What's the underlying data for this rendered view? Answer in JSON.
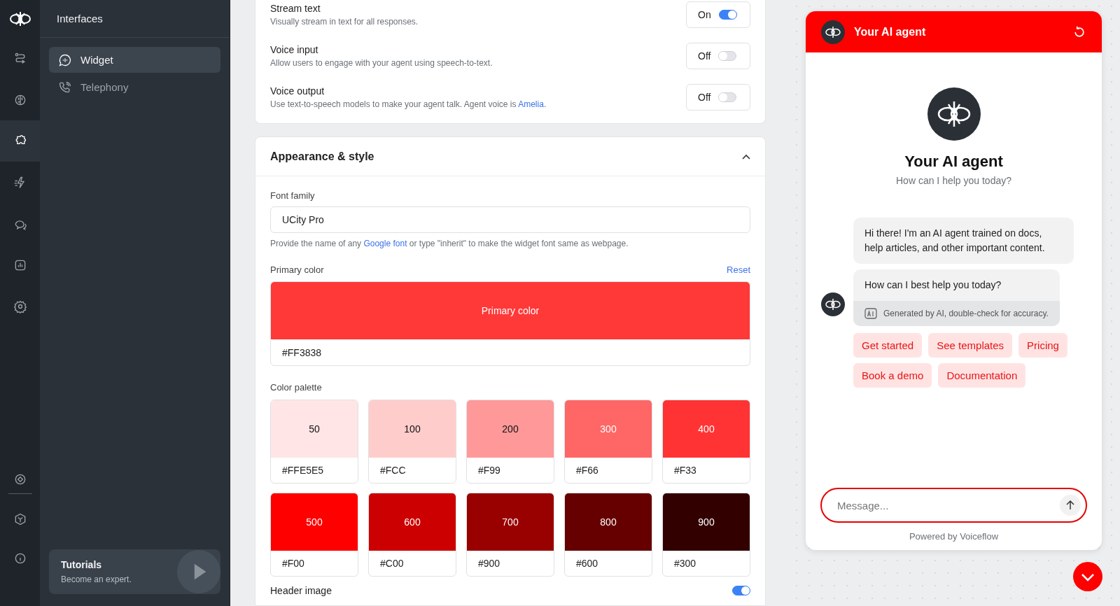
{
  "nav_rail": [
    {
      "selected": false
    },
    {
      "selected": false
    },
    {
      "selected": true
    },
    {
      "selected": false
    },
    {
      "selected": false
    },
    {
      "selected": false
    },
    {
      "selected": false
    }
  ],
  "sidebar": {
    "title": "Interfaces",
    "items": [
      {
        "label": "Widget",
        "selected": true
      },
      {
        "label": "Telephony",
        "selected": false
      }
    ],
    "tutorial": {
      "title": "Tutorials",
      "subtitle": "Become an expert."
    }
  },
  "toggles": [
    {
      "title": "Stream text",
      "description": "Visually stream in text for all responses.",
      "state_label": "On",
      "on": true
    },
    {
      "title": "Voice input",
      "description": "Allow users to engage with your agent using speech-to-text.",
      "state_label": "Off",
      "on": false
    },
    {
      "title": "Voice output",
      "description": "Use text-to-speech models to make your agent talk. Agent voice is ",
      "link": "Amelia",
      "description_end": ".",
      "state_label": "Off",
      "on": false
    }
  ],
  "appearance": {
    "title": "Appearance & style",
    "expanded": true,
    "font_family": {
      "label": "Font family",
      "value": "UCity Pro",
      "hint": "Provide the name of any ",
      "hint_link": "Google font",
      "hint_end": " or type \"inherit\" to make the widget font same as webpage."
    },
    "primary_color": {
      "label": "Primary color",
      "reset": "Reset",
      "preview": "Primary color",
      "value": "#FF3838"
    },
    "palette_label": "Color palette",
    "palette": [
      {
        "shade": "50",
        "hex": "#FFE5E5",
        "color": "#ffe5e5"
      },
      {
        "shade": "100",
        "hex": "#FCC",
        "color": "#ffcccc"
      },
      {
        "shade": "200",
        "hex": "#F99",
        "color": "#ff9999"
      },
      {
        "shade": "300",
        "hex": "#F66",
        "color": "#ff6666"
      },
      {
        "shade": "400",
        "hex": "#F33",
        "color": "#ff3333"
      },
      {
        "shade": "500",
        "hex": "#F00",
        "color": "#ff0000"
      },
      {
        "shade": "600",
        "hex": "#C00",
        "color": "#cc0000"
      },
      {
        "shade": "700",
        "hex": "#900",
        "color": "#990000"
      },
      {
        "shade": "800",
        "hex": "#600",
        "color": "#660000"
      },
      {
        "shade": "900",
        "hex": "#300",
        "color": "#330000"
      }
    ],
    "header_image": {
      "label": "Header image",
      "on": true
    }
  },
  "chat": {
    "header_title": "Your AI agent",
    "title": "Your AI agent",
    "subtitle": "How can I help you today?",
    "messages": [
      {
        "text": "Hi there! I'm an AI agent trained on docs, help articles, and other important content."
      },
      {
        "text": "How can I best help you today?",
        "note": "Generated by AI, double-check for accuracy."
      }
    ],
    "buttons": [
      "Get started",
      "See templates",
      "Pricing",
      "Book a demo",
      "Documentation"
    ],
    "input": {
      "placeholder": "Message..."
    },
    "footer": "Powered by Voiceflow"
  }
}
